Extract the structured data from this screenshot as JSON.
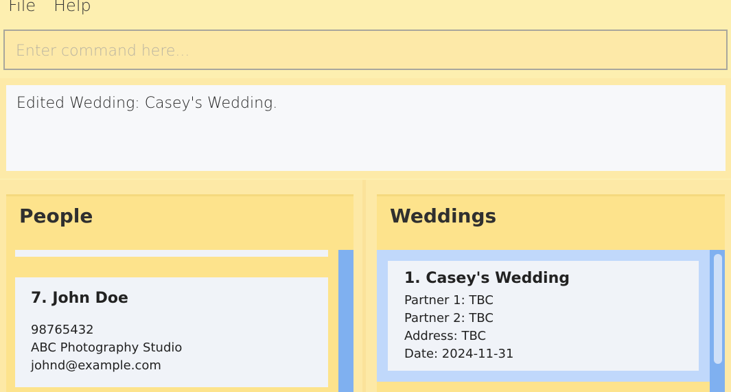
{
  "menu": {
    "file": "File",
    "help": "Help"
  },
  "command": {
    "placeholder": "Enter command here..."
  },
  "result": {
    "message": "Edited Wedding: Casey's Wedding."
  },
  "people": {
    "title": "People",
    "persons": [
      {
        "title": "7. John Doe",
        "phone": "98765432",
        "address": "ABC Photography Studio",
        "email": "johnd@example.com"
      }
    ]
  },
  "weddings": {
    "title": "Weddings",
    "items": [
      {
        "title": "1. Casey's Wedding",
        "partner1": "Partner 1: TBC",
        "partner2": "Partner 2: TBC",
        "address": "Address: TBC",
        "date": "Date: 2024-11-31"
      }
    ]
  }
}
